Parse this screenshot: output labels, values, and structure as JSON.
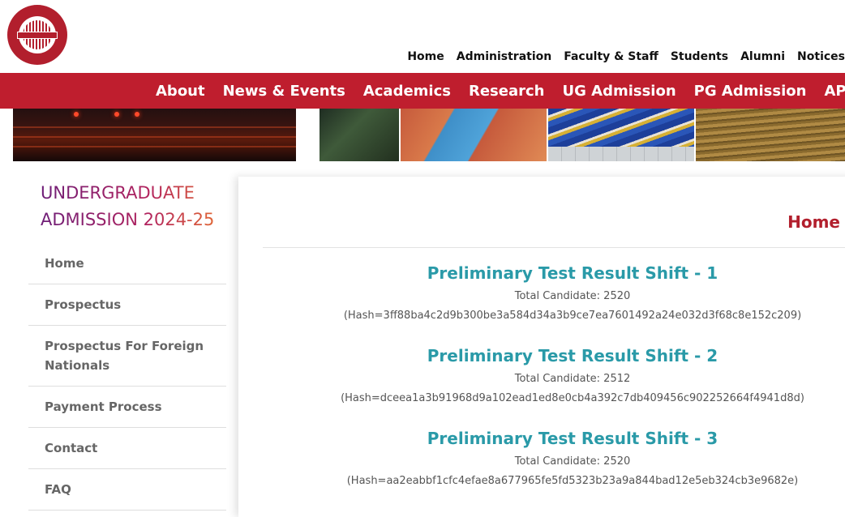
{
  "header": {
    "logo_icon": "university-seal-icon",
    "top_nav": [
      "Home",
      "Administration",
      "Faculty & Staff",
      "Students",
      "Alumni",
      "Notices"
    ]
  },
  "main_nav": [
    "About",
    "News & Events",
    "Academics",
    "Research",
    "UG Admission",
    "PG Admission",
    "APA"
  ],
  "sidebar": {
    "title_line1": "UNDERGRADUATE",
    "title_line2": "ADMISSION 2024-25",
    "items": [
      "Home",
      "Prospectus",
      "Prospectus For Foreign Nationals",
      "Payment Process",
      "Contact",
      "FAQ"
    ]
  },
  "content": {
    "breadcrumb": "Home",
    "results": [
      {
        "title": "Preliminary Test Result Shift - 1",
        "count": "Total Candidate: 2520",
        "hash": "(Hash=3ff88ba4c2d9b300be3a584d34a3b9ce7ea7601492a24e032d3f68c8e152c209)"
      },
      {
        "title": "Preliminary Test Result Shift - 2",
        "count": "Total Candidate: 2512",
        "hash": "(Hash=dceea1a3b91968d9a102ead1ed8e0cb4a392c7db409456c902252664f4941d8d)"
      },
      {
        "title": "Preliminary Test Result Shift - 3",
        "count": "Total Candidate: 2520",
        "hash": "(Hash=aa2eabbf1cfc4efae8a677965fe5fd5323b23a9a844bad12e5eb324cb3e9682e)"
      }
    ]
  },
  "colors": {
    "brand_red": "#bf1e2e",
    "link_teal": "#2a9aa8",
    "heading_gradient": [
      "#6e1e78",
      "#b2235e",
      "#ee7a2b"
    ]
  }
}
